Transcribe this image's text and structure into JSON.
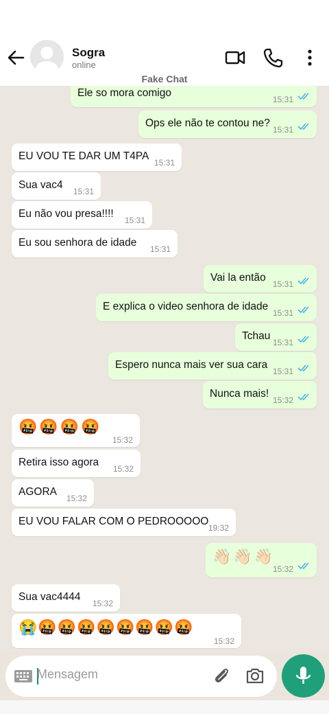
{
  "header": {
    "contact_name": "Sogra",
    "contact_status": "online",
    "watermark": "Fake Chat"
  },
  "messages": [
    {
      "text": "Ele so mora comigo",
      "time": "15:31",
      "dir": "out",
      "read": true
    },
    {
      "text": "Ops ele não te contou ne?",
      "time": "15:31",
      "dir": "out",
      "read": true
    },
    {
      "text": "EU VOU TE DAR UM T4PA",
      "time": "15:31",
      "dir": "in"
    },
    {
      "text": "Sua vac4",
      "time": "15:31",
      "dir": "in"
    },
    {
      "text": "Eu não vou presa!!!!",
      "time": "15:31",
      "dir": "in"
    },
    {
      "text": "Eu sou senhora de idade",
      "time": "15:31",
      "dir": "in"
    },
    {
      "text": "Vai la então",
      "time": "15:31",
      "dir": "out",
      "read": true
    },
    {
      "text": "E explica o video senhora de idade",
      "time": "15:31",
      "dir": "out",
      "read": true
    },
    {
      "text": "Tchau",
      "time": "15:31",
      "dir": "out",
      "read": true
    },
    {
      "text": "Espero nunca mais ver sua cara",
      "time": "15:31",
      "dir": "out",
      "read": true
    },
    {
      "text": "Nunca mais!",
      "time": "15:32",
      "dir": "out",
      "read": true
    },
    {
      "text": "🤬🤬🤬🤬",
      "time": "15:32",
      "dir": "in"
    },
    {
      "text": "Retira isso agora",
      "time": "15:32",
      "dir": "in"
    },
    {
      "text": "AGORA",
      "time": "15:32",
      "dir": "in"
    },
    {
      "text": "EU VOU FALAR COM O PEDROOOOO",
      "time": "19:32",
      "dir": "in"
    },
    {
      "text": "👋🏻👋🏻👋🏻",
      "time": "15:32",
      "dir": "out",
      "read": true
    },
    {
      "text": "Sua vac4444",
      "time": "15:32",
      "dir": "in"
    },
    {
      "text": "😭🤬🤬🤬🤬🤬🤬🤬🤬",
      "time": "15:32",
      "dir": "in"
    }
  ],
  "composer": {
    "placeholder": "Mensagem"
  },
  "colors": {
    "outgoing_bubble": "#e7ffdb",
    "incoming_bubble": "#ffffff",
    "chat_background": "#ebe6df",
    "read_tick": "#4fb6ec",
    "accent": "#1fa07a"
  },
  "icons": [
    "back-arrow-icon",
    "video-call-icon",
    "phone-icon",
    "more-options-icon",
    "keyboard-icon",
    "attach-icon",
    "camera-icon",
    "mic-icon"
  ]
}
